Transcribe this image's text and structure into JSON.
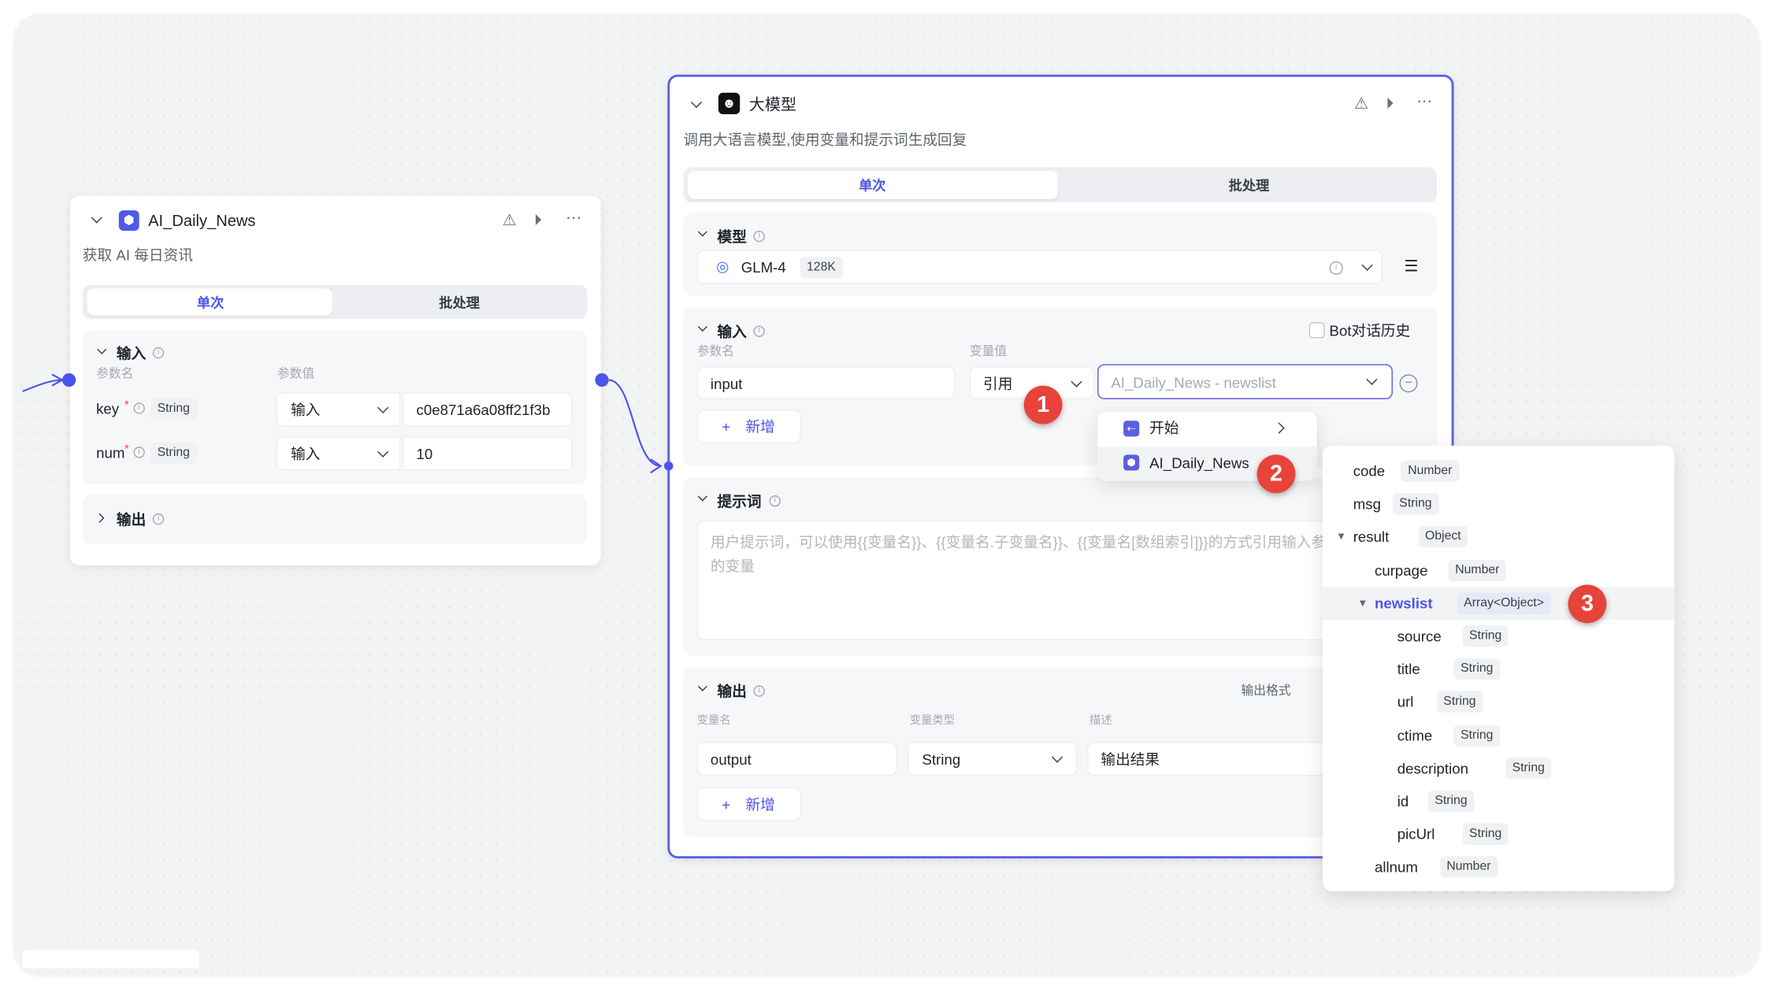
{
  "colors": {
    "accent": "#4d53e8",
    "badge": "#e8433a",
    "node_icon": "#4e5ae8"
  },
  "left_node": {
    "title": "AI_Daily_News",
    "description": "获取 AI 每日资讯",
    "tabs": [
      "单次",
      "批处理"
    ],
    "input": {
      "title": "输入",
      "col_name": "参数名",
      "col_value": "参数值",
      "rows": [
        {
          "name": "key",
          "type": "String",
          "mode": "输入",
          "value": "c0e871a6a08ff21f3b"
        },
        {
          "name": "num",
          "type": "String",
          "mode": "输入",
          "value": "10"
        }
      ]
    },
    "output": {
      "title": "输出"
    }
  },
  "right_node": {
    "title": "大模型",
    "description": "调用大语言模型,使用变量和提示词生成回复",
    "tabs": [
      "单次",
      "批处理"
    ],
    "model": {
      "title": "模型",
      "name": "GLM-4",
      "context": "128K"
    },
    "input": {
      "title": "输入",
      "bot_history": "Bot对话历史",
      "col_name": "参数名",
      "col_value": "变量值",
      "param_name": "input",
      "mode": "引用",
      "reference": "AI_Daily_News - newslist",
      "add": "新增"
    },
    "prompt": {
      "title": "提示词",
      "placeholder": "用户提示词，可以使用{{变量名}}、{{变量名.子变量名}}、{{变量名[数组索引]}}的方式引用输入参数中的变量"
    },
    "output": {
      "title": "输出",
      "format": "输出格式",
      "col_name": "变量名",
      "col_type": "变量类型",
      "col_desc": "描述",
      "name": "output",
      "type": "String",
      "desc": "输出结果",
      "add": "新增"
    }
  },
  "node_menu": {
    "items": [
      "开始",
      "AI_Daily_News"
    ]
  },
  "field_tree": [
    {
      "name": "code",
      "type": "Number",
      "level": 0
    },
    {
      "name": "msg",
      "type": "String",
      "level": 0
    },
    {
      "name": "result",
      "type": "Object",
      "level": 0,
      "expanded": true
    },
    {
      "name": "curpage",
      "type": "Number",
      "level": 1
    },
    {
      "name": "newslist",
      "type": "Array<Object>",
      "level": 1,
      "expanded": true,
      "selected": true
    },
    {
      "name": "source",
      "type": "String",
      "level": 2
    },
    {
      "name": "title",
      "type": "String",
      "level": 2
    },
    {
      "name": "url",
      "type": "String",
      "level": 2
    },
    {
      "name": "ctime",
      "type": "String",
      "level": 2
    },
    {
      "name": "description",
      "type": "String",
      "level": 2
    },
    {
      "name": "id",
      "type": "String",
      "level": 2
    },
    {
      "name": "picUrl",
      "type": "String",
      "level": 2
    },
    {
      "name": "allnum",
      "type": "Number",
      "level": 1
    }
  ],
  "steps": [
    "1",
    "2",
    "3"
  ]
}
